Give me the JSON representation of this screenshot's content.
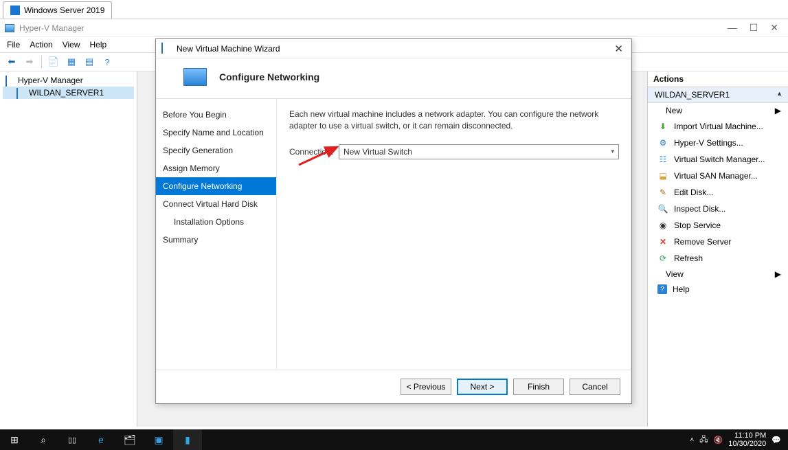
{
  "browser_tab": "Windows Server 2019",
  "app": {
    "title": "Hyper-V Manager",
    "menu": [
      "File",
      "Action",
      "View",
      "Help"
    ]
  },
  "tree": {
    "root": "Hyper-V Manager",
    "server": "WILDAN_SERVER1"
  },
  "wizard": {
    "title": "New Virtual Machine Wizard",
    "heading": "Configure Networking",
    "steps": [
      "Before You Begin",
      "Specify Name and Location",
      "Specify Generation",
      "Assign Memory",
      "Configure Networking",
      "Connect Virtual Hard Disk",
      "Installation Options",
      "Summary"
    ],
    "description": "Each new virtual machine includes a network adapter. You can configure the network adapter to use a virtual switch, or it can remain disconnected.",
    "connection_label": "Connection:",
    "connection_value": "New Virtual Switch",
    "buttons": {
      "previous": "< Previous",
      "next": "Next >",
      "finish": "Finish",
      "cancel": "Cancel"
    }
  },
  "actions": {
    "header": "Actions",
    "group": "WILDAN_SERVER1",
    "items": [
      "New",
      "Import Virtual Machine...",
      "Hyper-V Settings...",
      "Virtual Switch Manager...",
      "Virtual SAN Manager...",
      "Edit Disk...",
      "Inspect Disk...",
      "Stop Service",
      "Remove Server",
      "Refresh",
      "View",
      "Help"
    ]
  },
  "taskbar": {
    "time": "11:10 PM",
    "date": "10/30/2020"
  }
}
